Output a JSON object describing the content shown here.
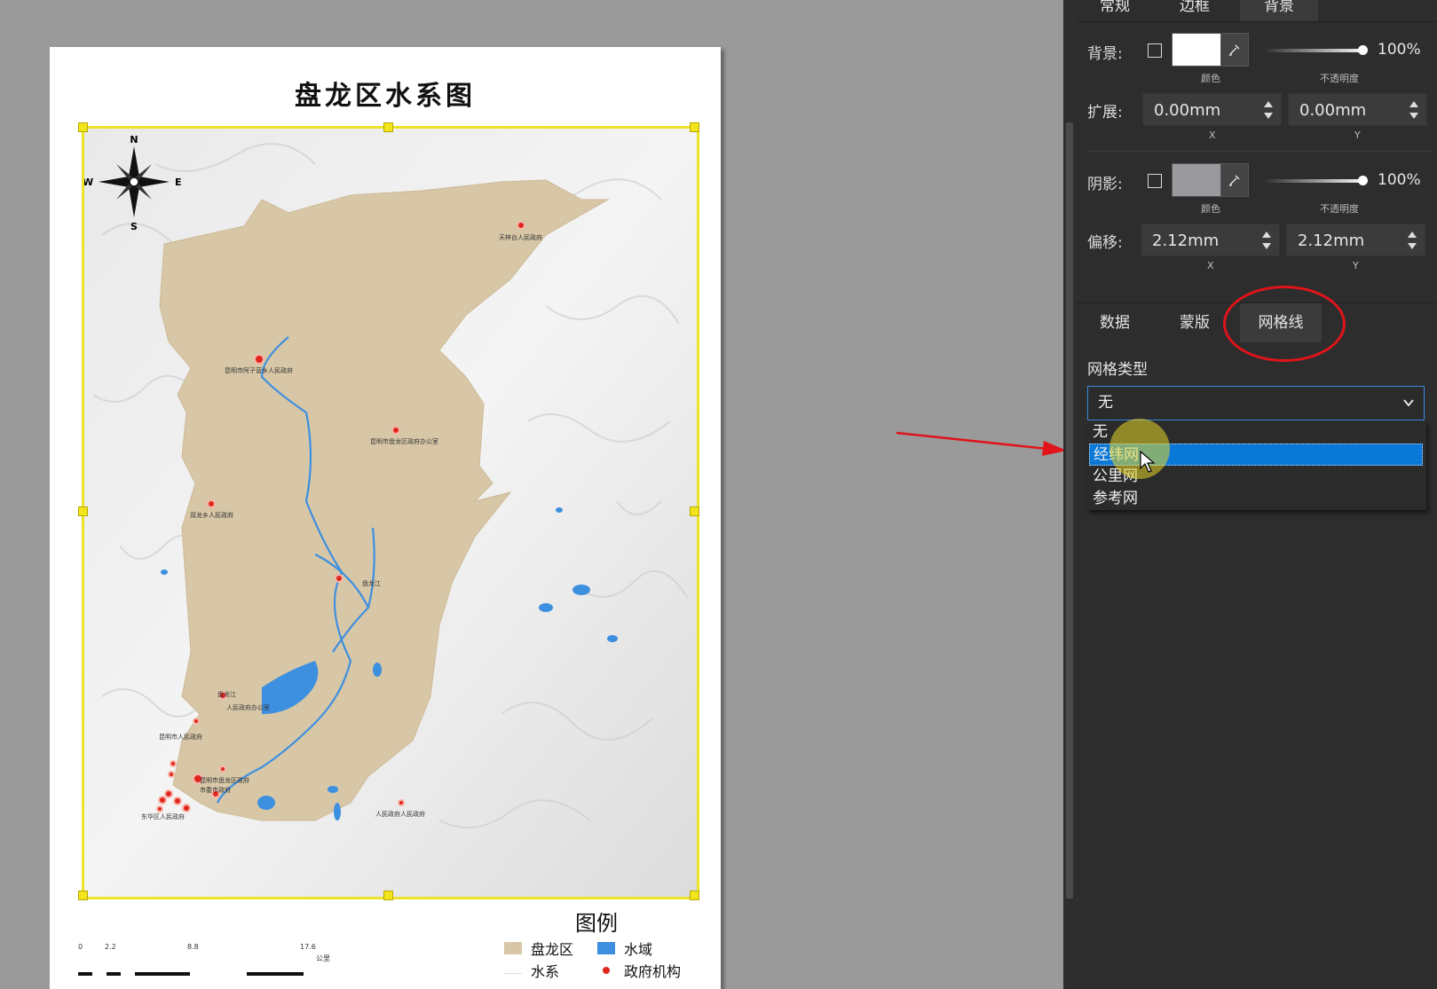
{
  "map": {
    "title": "盘龙区水系图",
    "compass": {
      "n": "N",
      "s": "S",
      "e": "E",
      "w": "W"
    },
    "place_labels": [
      "天梓台人民政府",
      "昆明市阿子营乡人民政府",
      "昆明市盘龙区政府办公室",
      "双龙乡人民政府",
      "盘龙江",
      "盘龙江",
      "人民政府办公室",
      "昆明市人民政府",
      "昆明市盘龙区政府",
      "市委市政府",
      "东华区人民政府",
      "人民政府人民政府"
    ],
    "legend": {
      "title": "图例",
      "items": [
        {
          "label": "盘龙区",
          "color": "#d8c7a7"
        },
        {
          "label": "水域",
          "color": "#3d8fe0"
        },
        {
          "label": "水系",
          "color": "#ffffff"
        },
        {
          "label": "政府机构",
          "color": "#e0271e"
        }
      ]
    },
    "scalebar": {
      "ticks": [
        "0",
        "2.2",
        "8.8",
        "17.6"
      ],
      "unit": "公里"
    }
  },
  "panel": {
    "top_tabs": [
      {
        "label": "常规",
        "active": false
      },
      {
        "label": "边框",
        "active": false
      },
      {
        "label": "背景",
        "active": true
      }
    ],
    "background": {
      "label": "背景:",
      "color": "#ffffff",
      "color_caption": "颜色",
      "opacity": "100%",
      "opacity_caption": "不透明度"
    },
    "extend": {
      "label": "扩展:",
      "x": "0.00mm",
      "y": "0.00mm",
      "x_caption": "X",
      "y_caption": "Y"
    },
    "shadow": {
      "label": "阴影:",
      "color": "#9a9a9e",
      "color_caption": "颜色",
      "opacity": "100%",
      "opacity_caption": "不透明度"
    },
    "offset": {
      "label": "偏移:",
      "x": "2.12mm",
      "y": "2.12mm",
      "x_caption": "X",
      "y_caption": "Y"
    },
    "section_tabs": [
      {
        "label": "数据",
        "active": false
      },
      {
        "label": "蒙版",
        "active": false
      },
      {
        "label": "网格线",
        "active": true
      }
    ],
    "grid_type": {
      "label": "网格类型",
      "selected": "无",
      "options": [
        "无",
        "经纬网",
        "公里网",
        "参考网"
      ],
      "highlighted": "经纬网"
    }
  },
  "colors": {
    "accent": "#0a78d7",
    "annotation": "#e0141a",
    "panel_bg": "#2d2d2d"
  }
}
